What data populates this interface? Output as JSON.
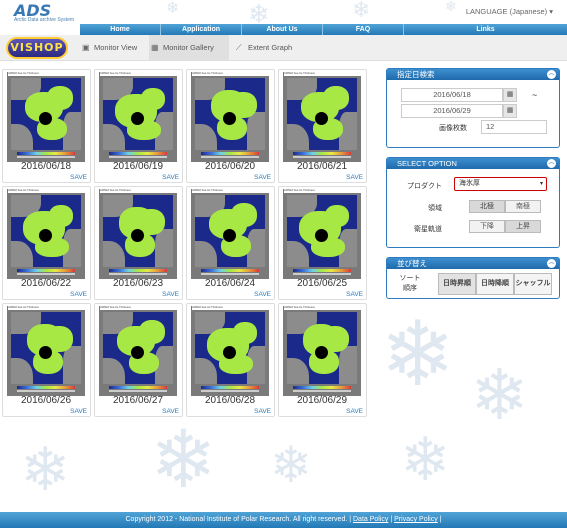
{
  "header": {
    "logo": "ADS",
    "logo_subtitle": "Arctic Data archive System",
    "language": "LANGUAGE (Japanese)"
  },
  "nav": [
    "Home",
    "Application",
    "About Us",
    "FAQ",
    "Links"
  ],
  "app_logo": "VISHOP",
  "tabs": [
    {
      "label": "Monitor View",
      "icon": "image-icon"
    },
    {
      "label": "Monitor Gallery",
      "icon": "grid-icon",
      "active": true
    },
    {
      "label": "Extent Graph",
      "icon": "line-chart-icon"
    }
  ],
  "gallery": {
    "map_caption": "AMSR2 Sea Ice Thickness",
    "save_label": "SAVE",
    "cards": [
      {
        "date": "2016/06/18"
      },
      {
        "date": "2016/06/19"
      },
      {
        "date": "2016/06/20"
      },
      {
        "date": "2016/06/21"
      },
      {
        "date": "2016/06/22"
      },
      {
        "date": "2016/06/23"
      },
      {
        "date": "2016/06/24"
      },
      {
        "date": "2016/06/25"
      },
      {
        "date": "2016/06/26"
      },
      {
        "date": "2016/06/27"
      },
      {
        "date": "2016/06/28"
      },
      {
        "date": "2016/06/29"
      }
    ]
  },
  "date_panel": {
    "title": "指定日検索",
    "start_date": "2016/06/18",
    "end_date": "2016/06/29",
    "range_sep": "~",
    "count_label": "画像枚数",
    "count_value": "12"
  },
  "option_panel": {
    "title": "SELECT OPTION",
    "product_label": "プロダクト",
    "product_value": "海氷厚",
    "region_label": "領域",
    "region_options": [
      "北極",
      "南極"
    ],
    "orbit_label": "衛星軌道",
    "orbit_options": [
      "下降",
      "上昇"
    ]
  },
  "sort_panel": {
    "title": "並び替え",
    "sort_label": "ソート順序",
    "options": [
      "日時昇順",
      "日時降順",
      "シャッフル"
    ]
  },
  "footer": {
    "copyright": "Copyright 2012 - National Institute of Polar Research. All right reserved. |",
    "data_policy": "Data Policy",
    "sep": "|",
    "privacy_policy": "Privacy Policy",
    "end": "|"
  }
}
